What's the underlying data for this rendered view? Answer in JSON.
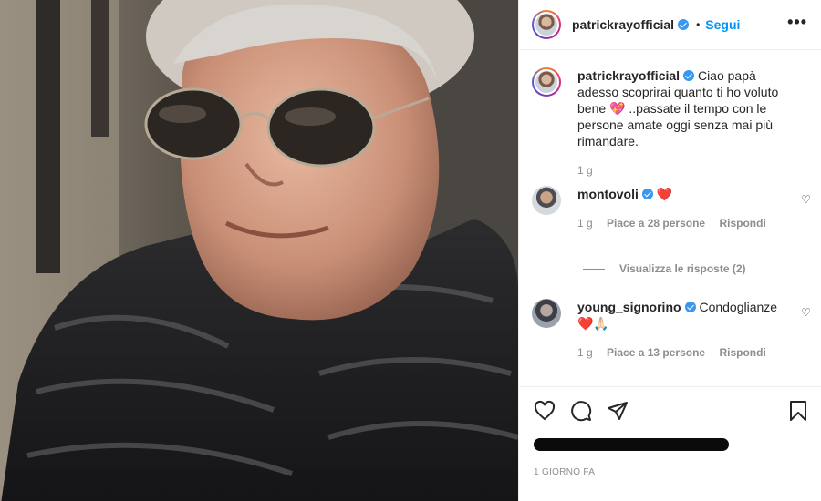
{
  "post": {
    "author": "patrickrayofficial",
    "follow_label": "Segui",
    "more_label": "•••",
    "separator": "•",
    "caption": {
      "username": "patrickrayofficial",
      "text": "Ciao papà adesso scoprirai quanto ti ho voluto bene 💖 ..passate il tempo con le persone amate oggi senza mai più rimandare.",
      "age": "1 g"
    },
    "comments": [
      {
        "username": "montovoli",
        "text": "❤️",
        "age": "1 g",
        "likes": "Piace a 28 persone",
        "reply": "Rispondi"
      },
      {
        "username": "young_signorino",
        "text": "Condoglianze ❤️🙏🏻",
        "age": "1 g",
        "likes": "Piace a 13 persone",
        "reply": "Rispondi"
      }
    ],
    "view_replies": "Visualizza le risposte (2)",
    "date_label": "1 GIORNO FA"
  },
  "colors": {
    "accent": "#0095f6",
    "verified": "#3897f0",
    "secondary_text": "#8e8e8e"
  },
  "icons": [
    "heart-icon",
    "comment-icon",
    "share-icon",
    "bookmark-icon",
    "more-options-icon",
    "verified-badge-icon"
  ]
}
